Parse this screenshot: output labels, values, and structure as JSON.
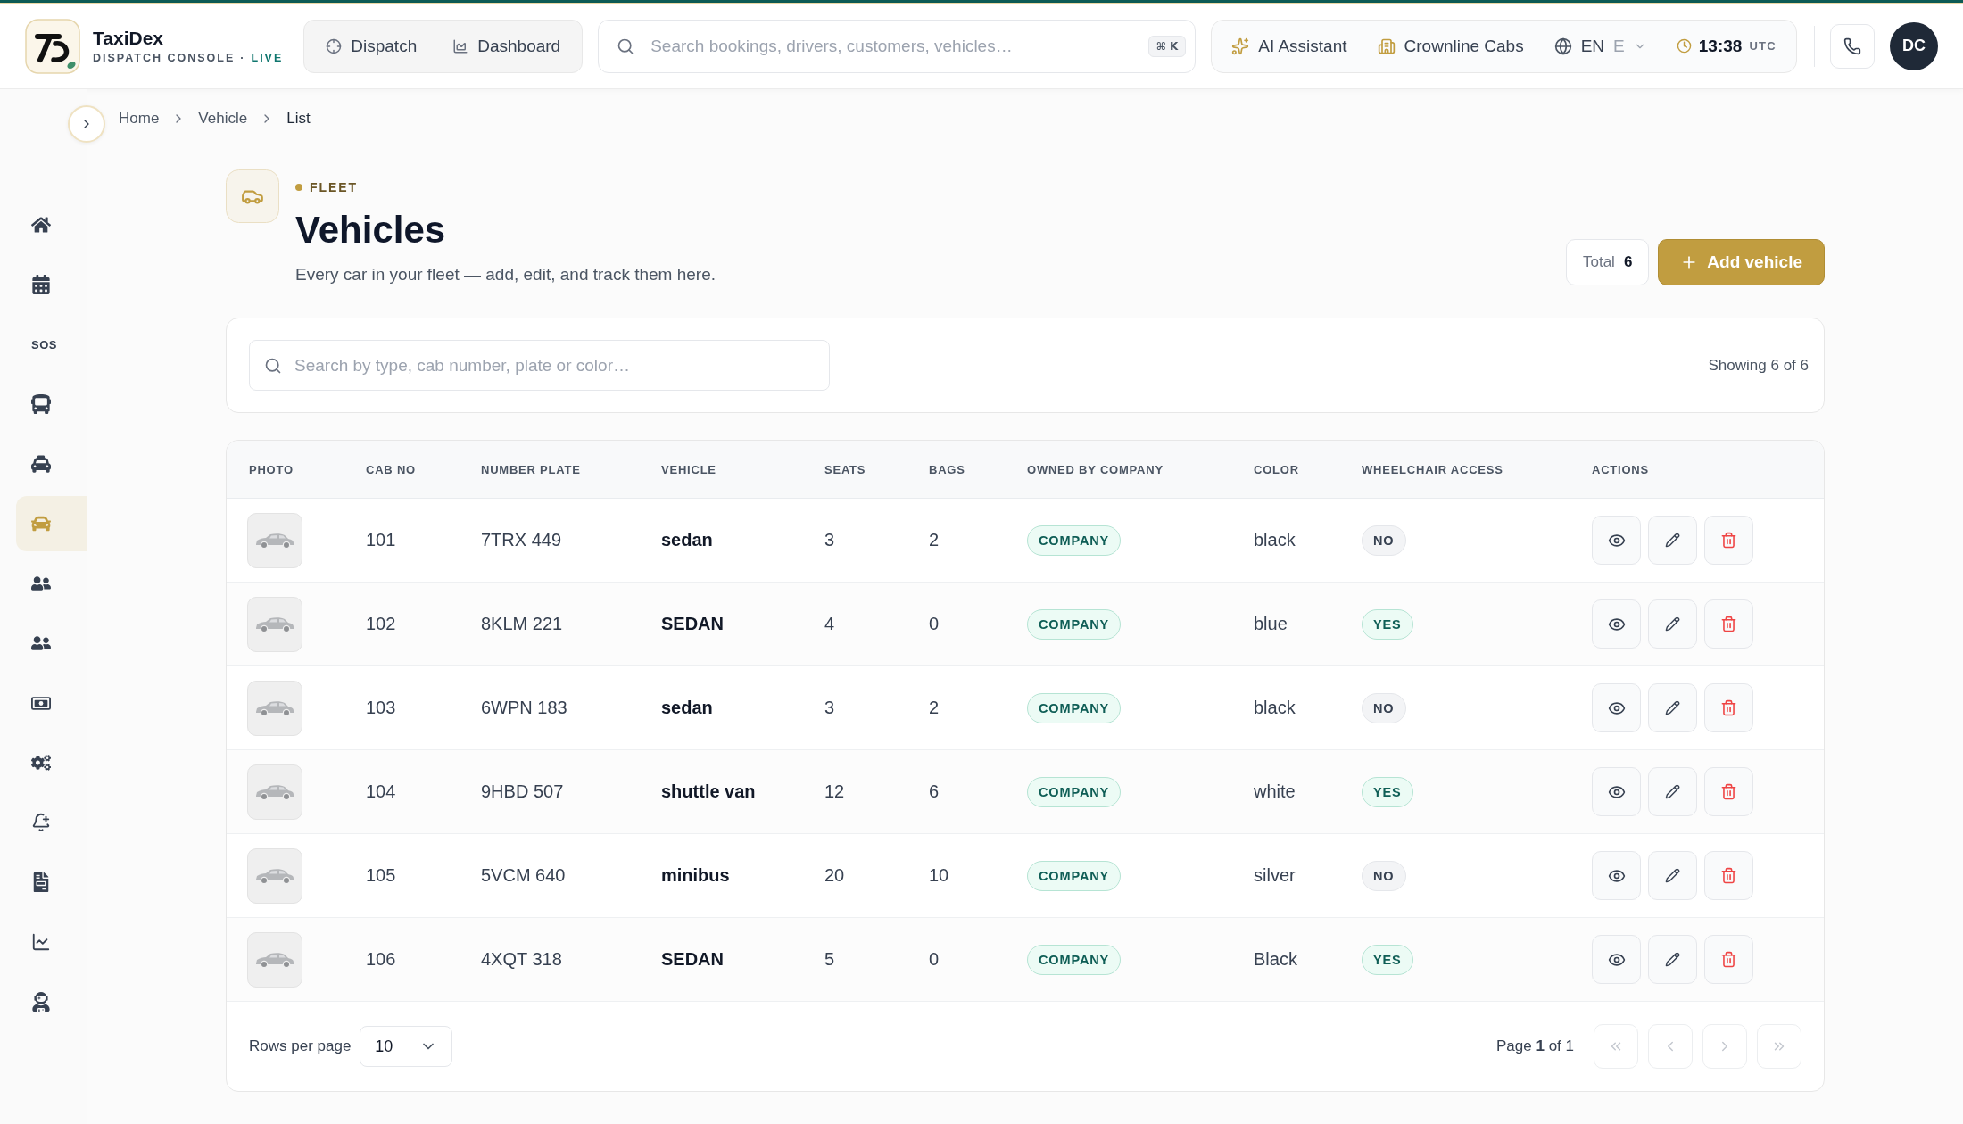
{
  "app": {
    "name": "TaxiDex",
    "subtitle": "DISPATCH CONSOLE",
    "separator": "·",
    "status": "LIVE"
  },
  "nav": [
    {
      "label": "Dispatch"
    },
    {
      "label": "Dashboard"
    }
  ],
  "search": {
    "placeholder": "Search bookings, drivers, customers, vehicles…",
    "shortcut": "⌘ K"
  },
  "toolbar": {
    "assistant": "AI Assistant",
    "company": "Crownline Cabs",
    "language_code": "EN",
    "language_name": "E",
    "time": "13:38",
    "timezone": "UTC"
  },
  "user": {
    "initials": "DC"
  },
  "sidebar": {
    "items": [
      {
        "kind": "icon",
        "selected": false
      },
      {
        "kind": "icon",
        "selected": false
      },
      {
        "kind": "text",
        "label": "SOS",
        "selected": false
      },
      {
        "kind": "icon",
        "selected": false
      },
      {
        "kind": "icon",
        "selected": false
      },
      {
        "kind": "icon",
        "selected": true
      },
      {
        "kind": "icon",
        "selected": false
      },
      {
        "kind": "icon",
        "selected": false
      },
      {
        "kind": "icon",
        "selected": false
      },
      {
        "kind": "icon",
        "selected": false
      },
      {
        "kind": "icon",
        "selected": false
      },
      {
        "kind": "icon",
        "selected": false
      },
      {
        "kind": "icon",
        "selected": false
      },
      {
        "kind": "icon",
        "selected": false
      }
    ]
  },
  "breadcrumb": [
    "Home",
    "Vehicle",
    "List"
  ],
  "page": {
    "eyebrow": "FLEET",
    "title": "Vehicles",
    "subtitle": "Every car in your fleet — add, edit, and track them here.",
    "total_label": "Total",
    "total": "6",
    "add_button": "Add vehicle"
  },
  "filter": {
    "placeholder": "Search by type, cab number, plate or color…",
    "showing": "Showing 6 of 6"
  },
  "table": {
    "columns": [
      "PHOTO",
      "CAB NO",
      "NUMBER PLATE",
      "VEHICLE",
      "SEATS",
      "BAGS",
      "OWNED BY COMPANY",
      "COLOR",
      "WHEELCHAIR ACCESS",
      "ACTIONS"
    ],
    "rows": [
      {
        "cab_no": "101",
        "number_plate": "7TRX 449",
        "vehicle": "sedan",
        "seats": "3",
        "bags": "2",
        "owned_by": "COMPANY",
        "vehicle_color": "black",
        "wheelchair_access": false,
        "wheelchair_label": "NO"
      },
      {
        "cab_no": "102",
        "number_plate": "8KLM 221",
        "vehicle": "SEDAN",
        "seats": "4",
        "bags": "0",
        "owned_by": "COMPANY",
        "vehicle_color": "blue",
        "wheelchair_access": true,
        "wheelchair_label": "YES"
      },
      {
        "cab_no": "103",
        "number_plate": "6WPN 183",
        "vehicle": "sedan",
        "seats": "3",
        "bags": "2",
        "owned_by": "COMPANY",
        "vehicle_color": "black",
        "wheelchair_access": false,
        "wheelchair_label": "NO"
      },
      {
        "cab_no": "104",
        "number_plate": "9HBD 507",
        "vehicle": "shuttle van",
        "seats": "12",
        "bags": "6",
        "owned_by": "COMPANY",
        "vehicle_color": "white",
        "wheelchair_access": true,
        "wheelchair_label": "YES"
      },
      {
        "cab_no": "105",
        "number_plate": "5VCM 640",
        "vehicle": "minibus",
        "seats": "20",
        "bags": "10",
        "owned_by": "COMPANY",
        "vehicle_color": "silver",
        "wheelchair_access": false,
        "wheelchair_label": "NO"
      },
      {
        "cab_no": "106",
        "number_plate": "4XQT 318",
        "vehicle": "SEDAN",
        "seats": "5",
        "bags": "0",
        "owned_by": "COMPANY",
        "vehicle_color": "Black",
        "wheelchair_access": true,
        "wheelchair_label": "YES"
      }
    ]
  },
  "pagination": {
    "rows_label": "Rows per page",
    "rows_value": "10",
    "page_label": "Page **1** of 1",
    "buttons": [
      {
        "disabled": true
      },
      {
        "disabled": true
      },
      {
        "disabled": true
      },
      {
        "disabled": true
      }
    ]
  }
}
